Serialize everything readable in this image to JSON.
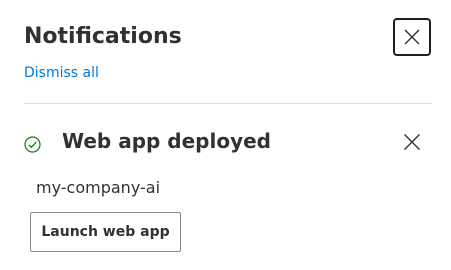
{
  "panel": {
    "title": "Notifications",
    "dismiss_all_label": "Dismiss all",
    "close_icon": "close-icon"
  },
  "notification": {
    "status_icon": "success-check-icon",
    "status_color": "#107c10",
    "title": "Web app deployed",
    "body": "my-company-ai",
    "action_label": "Launch web app",
    "close_icon": "close-icon"
  },
  "colors": {
    "link": "#0078d4",
    "text": "#323130",
    "divider": "#e1dfdd"
  }
}
